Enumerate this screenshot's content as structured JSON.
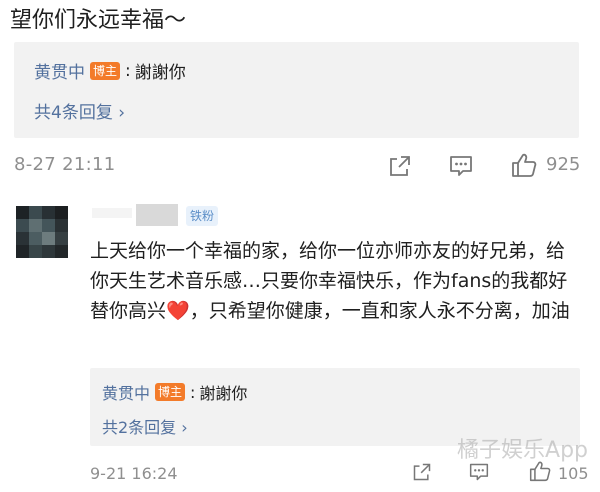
{
  "comment1": {
    "text": "望你们永远幸福～",
    "reply": {
      "author": "黄贯中",
      "badge": "博主",
      "colon": ":",
      "text": "謝謝你",
      "more": "共4条回复 ›"
    },
    "time": "8-27 21:11",
    "likes": "925"
  },
  "comment2": {
    "badge": "铁粉",
    "body_main": "上天给你一个幸福的家，给你一位亦师亦友的好兄弟，给你天生艺术音乐感…只要你幸福快乐，作为fans的我都好替你高兴",
    "heart": "❤️",
    "body_end": "，只希望你健康，一直和家人永不分离，加油",
    "reply": {
      "author": "黄贯中",
      "badge": "博主",
      "colon": ":",
      "text": "謝謝你",
      "more": "共2条回复 ›"
    },
    "time": "9-21 16:24",
    "likes": "105"
  },
  "watermark": "橘子娱乐App",
  "colors": {
    "link": "#53719e",
    "badge_orange": "#f37b2a",
    "muted": "#8f8f8f",
    "reply_bg": "#f2f2f2"
  },
  "icons": [
    "share-icon",
    "comment-icon",
    "like-icon"
  ]
}
